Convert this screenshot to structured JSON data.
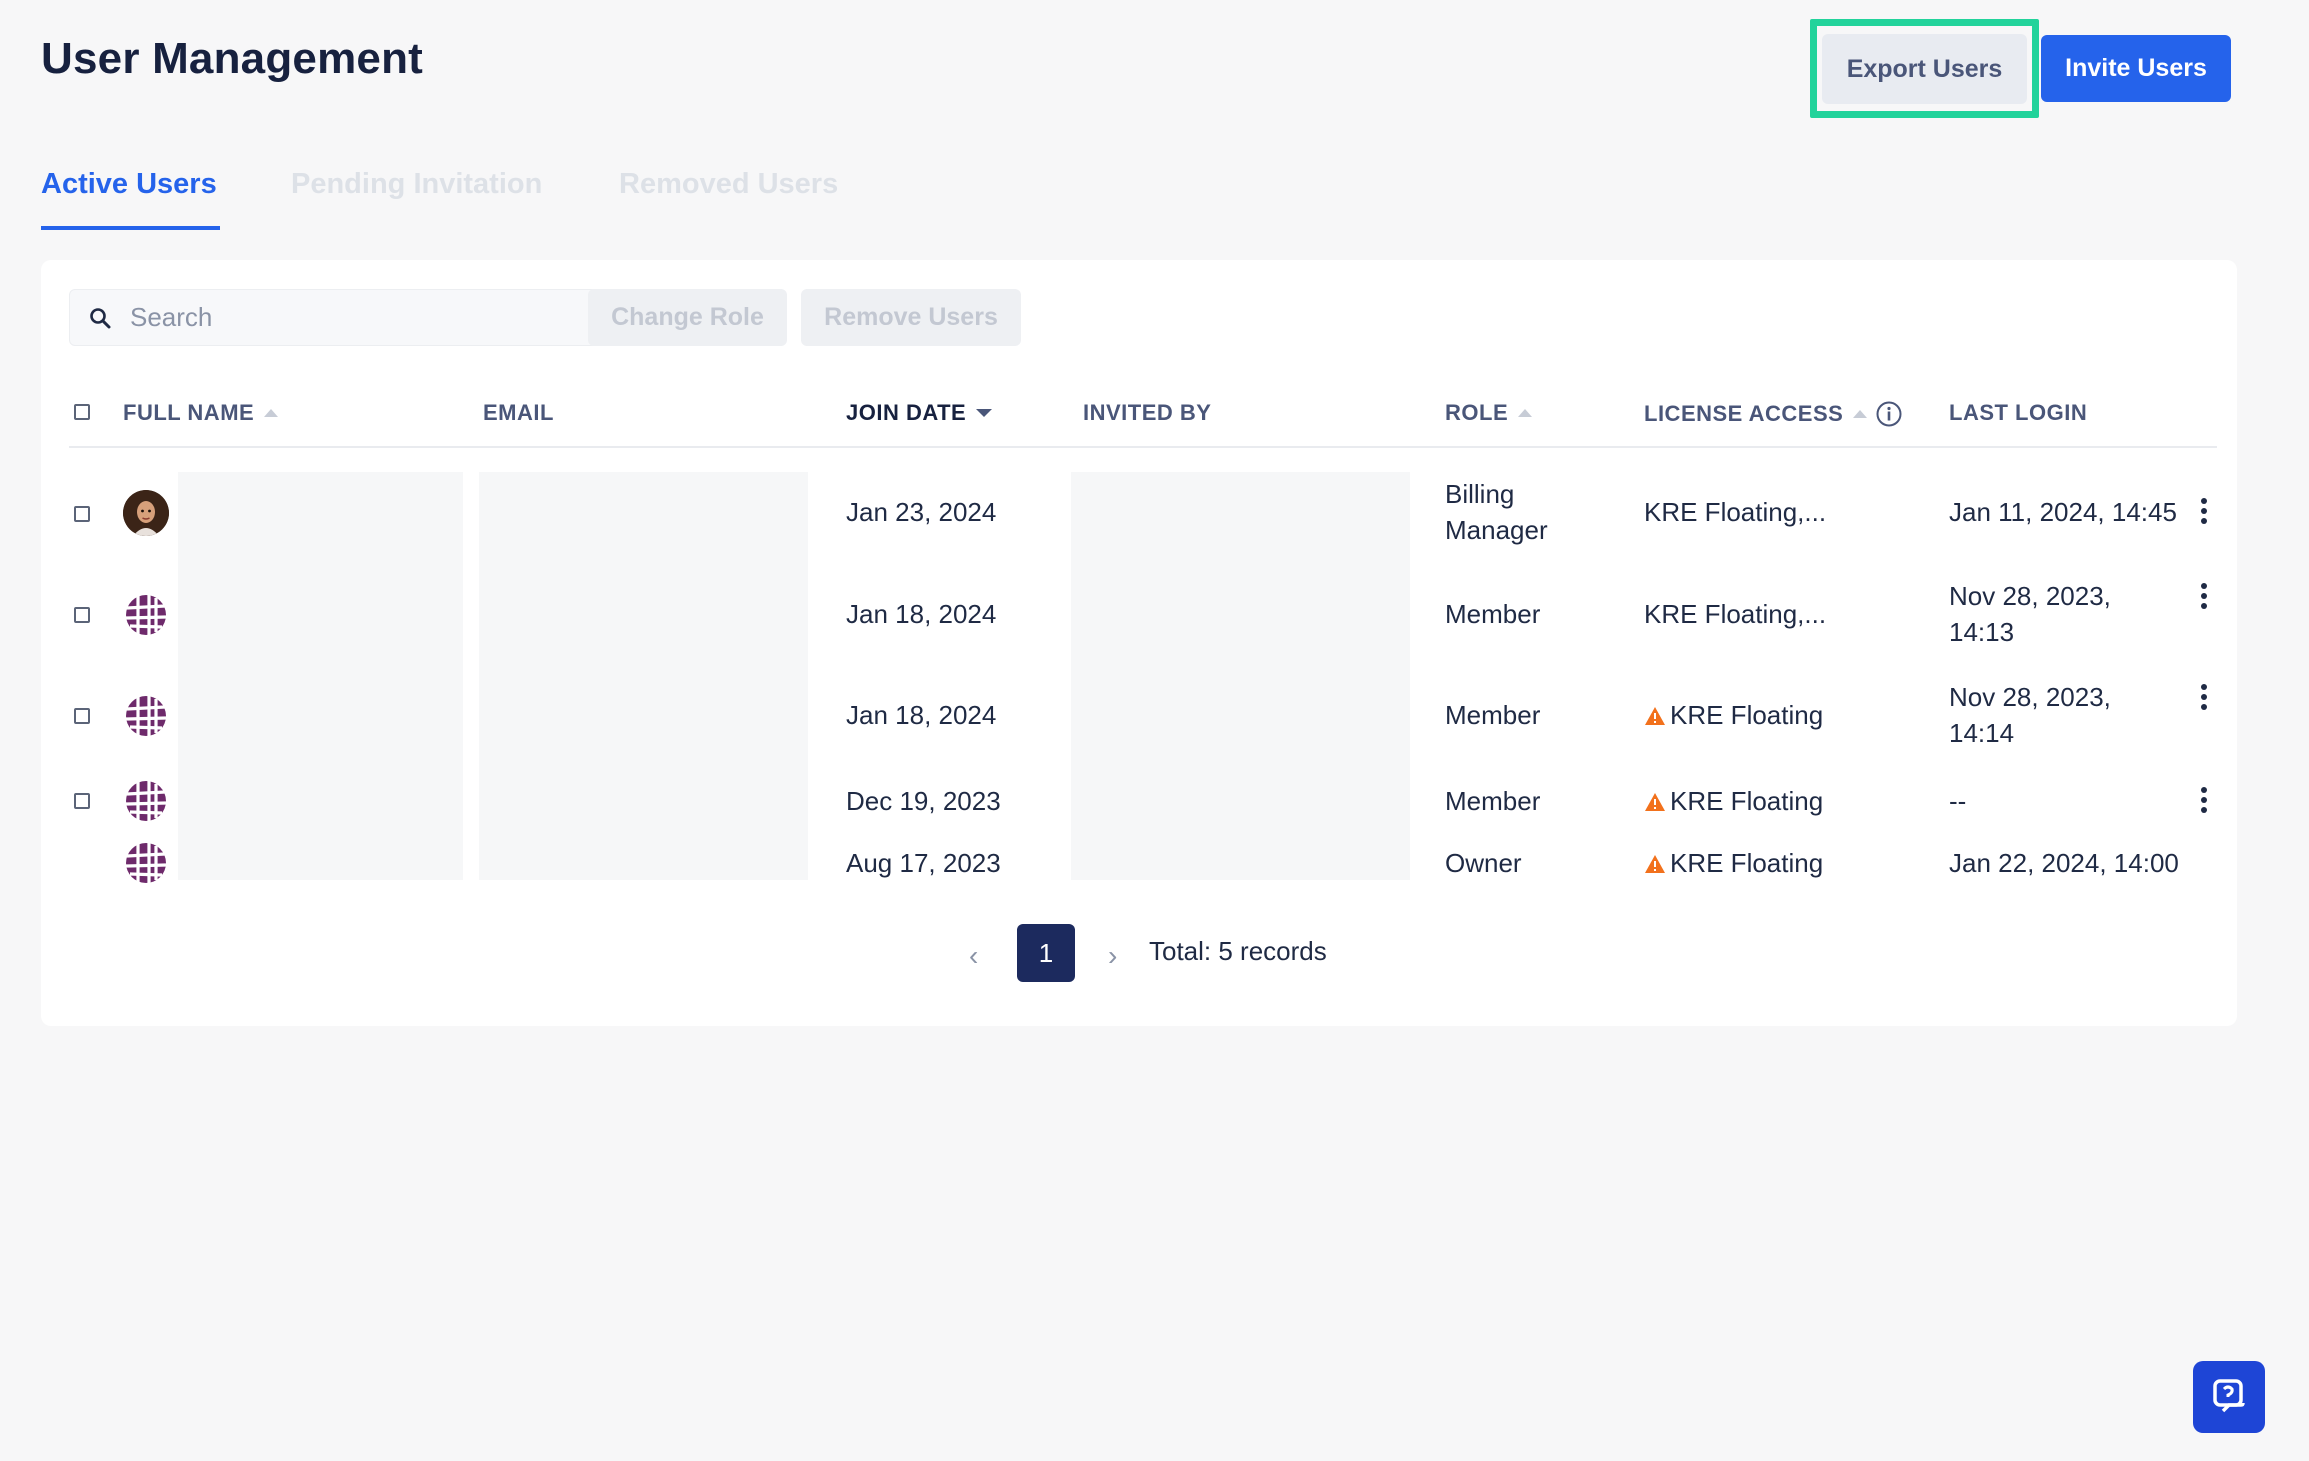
{
  "header": {
    "title": "User Management",
    "export_label": "Export Users",
    "invite_label": "Invite Users"
  },
  "tabs": [
    {
      "label": "Active Users",
      "active": true
    },
    {
      "label": "Pending Invitation",
      "active": false
    },
    {
      "label": "Removed Users",
      "active": false
    }
  ],
  "toolbar": {
    "search_placeholder": "Search",
    "search_value": "",
    "change_role_label": "Change Role",
    "remove_users_label": "Remove Users"
  },
  "columns": {
    "full_name": "FULL NAME",
    "email": "EMAIL",
    "join_date": "JOIN DATE",
    "invited_by": "INVITED BY",
    "role": "ROLE",
    "license_access": "LICENSE ACCESS",
    "last_login": "LAST LOGIN"
  },
  "rows": [
    {
      "avatar": "person-photo",
      "join_date": "Jan 23, 2024",
      "role_line1": "Billing",
      "role_line2": "Manager",
      "license": "KRE Floating,...",
      "license_warning": false,
      "last_login_line1": "Jan 11, 2024, 14:45",
      "last_login_line2": "",
      "has_checkbox": true,
      "has_menu": true
    },
    {
      "avatar": "globe-icon",
      "join_date": "Jan 18, 2024",
      "role_line1": "Member",
      "role_line2": "",
      "license": "KRE Floating,...",
      "license_warning": false,
      "last_login_line1": "Nov 28, 2023,",
      "last_login_line2": "14:13",
      "has_checkbox": true,
      "has_menu": true
    },
    {
      "avatar": "globe-icon",
      "join_date": "Jan 18, 2024",
      "role_line1": "Member",
      "role_line2": "",
      "license": "KRE Floating",
      "license_warning": true,
      "last_login_line1": "Nov 28, 2023,",
      "last_login_line2": "14:14",
      "has_checkbox": true,
      "has_menu": true
    },
    {
      "avatar": "globe-icon",
      "join_date": "Dec 19, 2023",
      "role_line1": "Member",
      "role_line2": "",
      "license": "KRE Floating",
      "license_warning": true,
      "last_login_line1": "--",
      "last_login_line2": "",
      "has_checkbox": true,
      "has_menu": true
    },
    {
      "avatar": "globe-icon",
      "join_date": "Aug 17, 2023",
      "role_line1": "Owner",
      "role_line2": "",
      "license": "KRE Floating",
      "license_warning": true,
      "last_login_line1": "Jan 22, 2024, 14:00",
      "last_login_line2": "",
      "has_checkbox": false,
      "has_menu": false
    }
  ],
  "pagination": {
    "current_page": "1",
    "total_label": "Total: 5 records"
  },
  "colors": {
    "accent": "#2563eb",
    "highlight": "#22d39b",
    "warning": "#f2711c",
    "avatar_purple": "#6e2a6b"
  }
}
